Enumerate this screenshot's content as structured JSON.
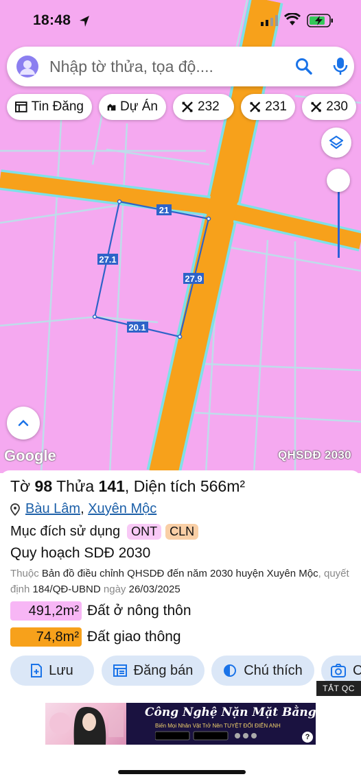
{
  "status_bar": {
    "time": "18:48"
  },
  "search": {
    "placeholder": "Nhập tờ thửa, tọa độ...."
  },
  "chips": [
    {
      "label": "Tin Đăng",
      "icon": "newspaper-icon"
    },
    {
      "label": "Dự Án",
      "icon": "buildings-icon"
    },
    {
      "label": "232",
      "icon": "survey-map-icon"
    },
    {
      "label": "231",
      "icon": "survey-map-icon"
    },
    {
      "label": "230",
      "icon": "survey-map-icon"
    }
  ],
  "map": {
    "edge_labels": [
      "21",
      "27.1",
      "27.9",
      "20.1"
    ],
    "attribution": "Google",
    "layer_label": "QHSDĐ 2030",
    "colors": {
      "residential": "#f5a9f0",
      "road": "#f7a11b",
      "boundary": "#2d63c8"
    }
  },
  "parcel": {
    "sheet_label": "Tờ",
    "sheet": "98",
    "plot_label": "Thửa",
    "plot": "141",
    "area_label": "Diện tích",
    "area": "566m²",
    "ward": "Bàu Lâm",
    "district": "Xuyên Mộc",
    "purpose_label": "Mục đích sử dụng",
    "purpose_tags": [
      "ONT",
      "CLN"
    ],
    "plan_title": "Quy hoạch SDĐ 2030",
    "plan_prefix": "Thuộc",
    "plan_map": "Bản đồ điều chỉnh QHSDĐ đến năm 2030 huyện Xuyên Mộc",
    "plan_mid": ", quyết định",
    "plan_decision": "184/QĐ-UBND",
    "plan_date_label": "ngày",
    "plan_date": "26/03/2025",
    "land_uses": [
      {
        "area": "491,2m²",
        "label": "Đất ở nông thôn",
        "color": "#f7b6f5"
      },
      {
        "area": "74,8m²",
        "label": "Đất giao thông",
        "color": "#f7a11b"
      }
    ]
  },
  "actions": [
    {
      "label": "Lưu",
      "icon": "save-icon"
    },
    {
      "label": "Đăng bán",
      "icon": "listing-icon"
    },
    {
      "label": "Chú thích",
      "icon": "legend-icon"
    },
    {
      "label": "C",
      "icon": "camera-icon"
    }
  ],
  "ad": {
    "close_label": "TẮT QC",
    "title": "Công Nghệ Nặn Mặt Bằng Ai",
    "subtitle": "Biến Mọi Nhân Vật Trở Nên TUYỆT ĐỐI ĐIỂN ANH",
    "help": "?"
  }
}
